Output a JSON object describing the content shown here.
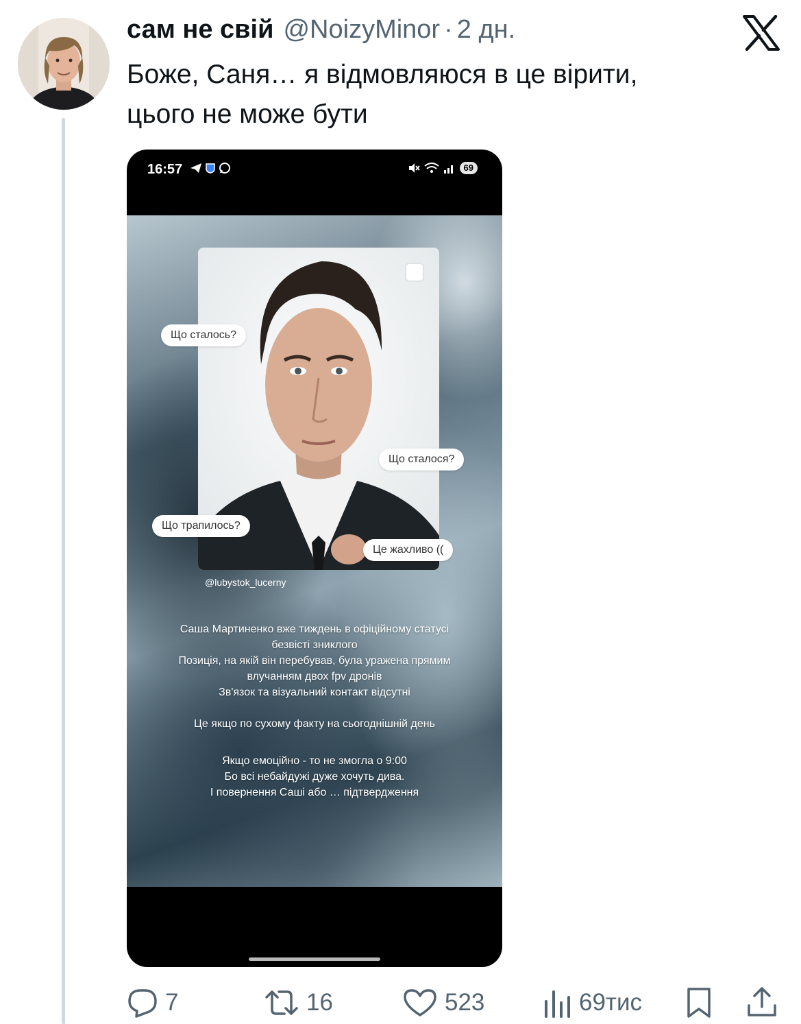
{
  "tweet": {
    "display_name": "сам не свій",
    "handle": "@NoizyMinor",
    "separator": "·",
    "time": "2 дн.",
    "text_line1": "Боже, Саня… я відмовляюся в це вірити,",
    "text_line2": "цього не може бути"
  },
  "phone": {
    "status_time": "16:57",
    "battery": "69",
    "story": {
      "bubbles": [
        "Що сталось?",
        "Що сталося?",
        "Що трапилось?",
        "Це жахливо (("
      ],
      "author_tag": "@lubystok_lucerny",
      "lines": [
        "Саша Мартиненко  вже тиждень в офіційному статусі",
        "безвісті зниклого",
        "Позиція, на якій він перебував, була уражена прямим",
        "влучанням двох  fpv дронів",
        "Зв'язок та візуальний контакт відсутні",
        "Це якщо по сухому факту на сьогоднішній день",
        "Якщо емоційно - то не змогла о 9:00",
        "Бо всі небайдужі дуже хочуть дива.",
        "І повернення Саші або … підтвердження"
      ]
    }
  },
  "actions": {
    "replies": "7",
    "reposts": "16",
    "likes": "523",
    "views": "69тис"
  },
  "icons": {
    "x_logo": "x-logo-icon",
    "reply": "reply-icon",
    "repost": "repost-icon",
    "like": "heart-icon",
    "views": "views-icon",
    "bookmark": "bookmark-icon",
    "share": "share-icon"
  },
  "colors": {
    "text_primary": "#0f1419",
    "text_secondary": "#536471",
    "thread_line": "#cfd9de"
  }
}
